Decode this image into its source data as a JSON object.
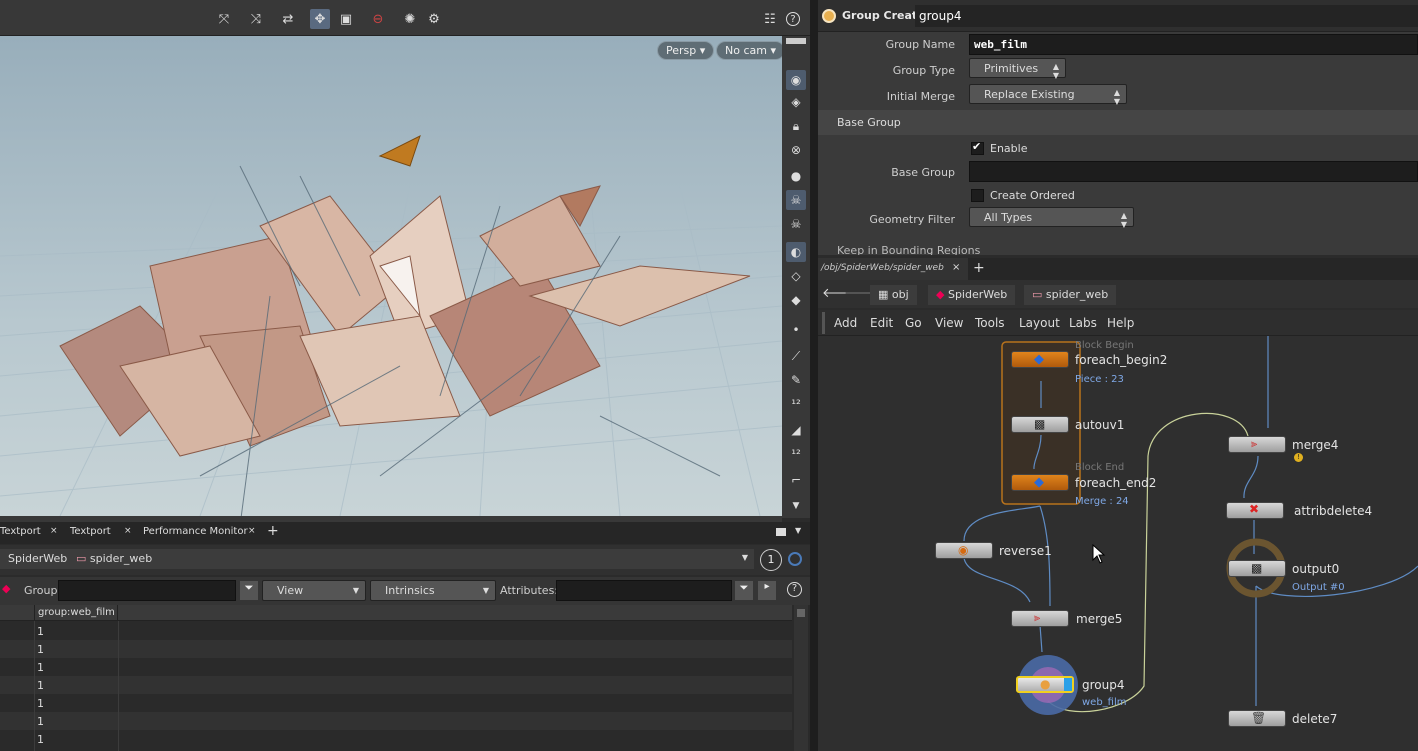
{
  "viewport": {
    "persp_label": "Persp",
    "cam_label": "No cam"
  },
  "params": {
    "node_type": "Group Create",
    "node_name": "group4",
    "group_name_label": "Group Name",
    "group_name_value": "web_film",
    "group_type_label": "Group Type",
    "group_type_value": "Primitives",
    "initial_merge_label": "Initial Merge",
    "initial_merge_value": "Replace Existing",
    "base_group_section": "Base Group",
    "enable_label": "Enable",
    "base_group_label": "Base Group",
    "create_ordered_label": "Create Ordered",
    "geometry_filter_label": "Geometry Filter",
    "geometry_filter_value": "All Types",
    "next_section": "Keep in Bounding Regions"
  },
  "network": {
    "tab_label": "/obj/SpiderWeb/spider_web",
    "path": [
      "obj",
      "SpiderWeb",
      "spider_web"
    ],
    "menu": [
      "Add",
      "Edit",
      "Go",
      "View",
      "Tools",
      "Layout",
      "Labs",
      "Help"
    ],
    "nodes": {
      "block_begin_tag": "Block Begin",
      "foreach_begin": "foreach_begin2",
      "foreach_begin_sub": "Piece : 23",
      "autouv": "autouv1",
      "block_end_tag": "Block End",
      "foreach_end": "foreach_end2",
      "foreach_end_sub": "Merge : 24",
      "reverse": "reverse1",
      "merge5": "merge5",
      "group4": "group4",
      "group4_sub": "web_film",
      "merge4": "merge4",
      "attribdelete": "attribdelete4",
      "output": "output0",
      "output_sub": "Output #0",
      "delete": "delete7"
    }
  },
  "bottom": {
    "tabs": [
      "Textport",
      "Textport",
      "Performance Monitor"
    ],
    "path": [
      "SpiderWeb",
      "spider_web"
    ],
    "badge": "1",
    "group_label": "Group:",
    "view_label": "View",
    "intrinsics_label": "Intrinsics",
    "attributes_label": "Attributes:",
    "column_header": "group:web_film",
    "rows": [
      "1",
      "1",
      "1",
      "1",
      "1",
      "1",
      "1"
    ]
  }
}
